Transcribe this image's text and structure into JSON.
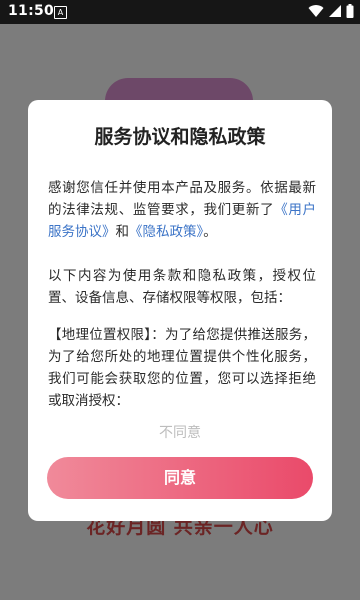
{
  "status_bar": {
    "time": "11:50",
    "notification_icon": "notification-a-icon"
  },
  "background": {
    "slogan": "花好月圆 共亲一人心"
  },
  "dialog": {
    "title": "服务协议和隐私政策",
    "intro_text": "感谢您信任并使用本产品及服务。依据最新的法律法规、监管要求，我们更新了",
    "user_agreement_link": "《用户服务协议》",
    "and_text": "和",
    "privacy_link": "《隐私政策》",
    "intro_end": "。",
    "permissions_text": "以下内容为使用条款和隐私政策，授权位置、设备信息、存储权限等权限，包括：",
    "location_text": "【地理位置权限】：为了给您提供推送服务，为了给您所处的地理位置提供个性化服务，我们可能会获取您的位置，您可以选择拒绝或取消授权：",
    "disagree_label": "不同意",
    "agree_label": "同意"
  },
  "colors": {
    "link": "#3c74c7",
    "button_gradient_start": "#f08a9a",
    "button_gradient_end": "#ea4a6a"
  }
}
